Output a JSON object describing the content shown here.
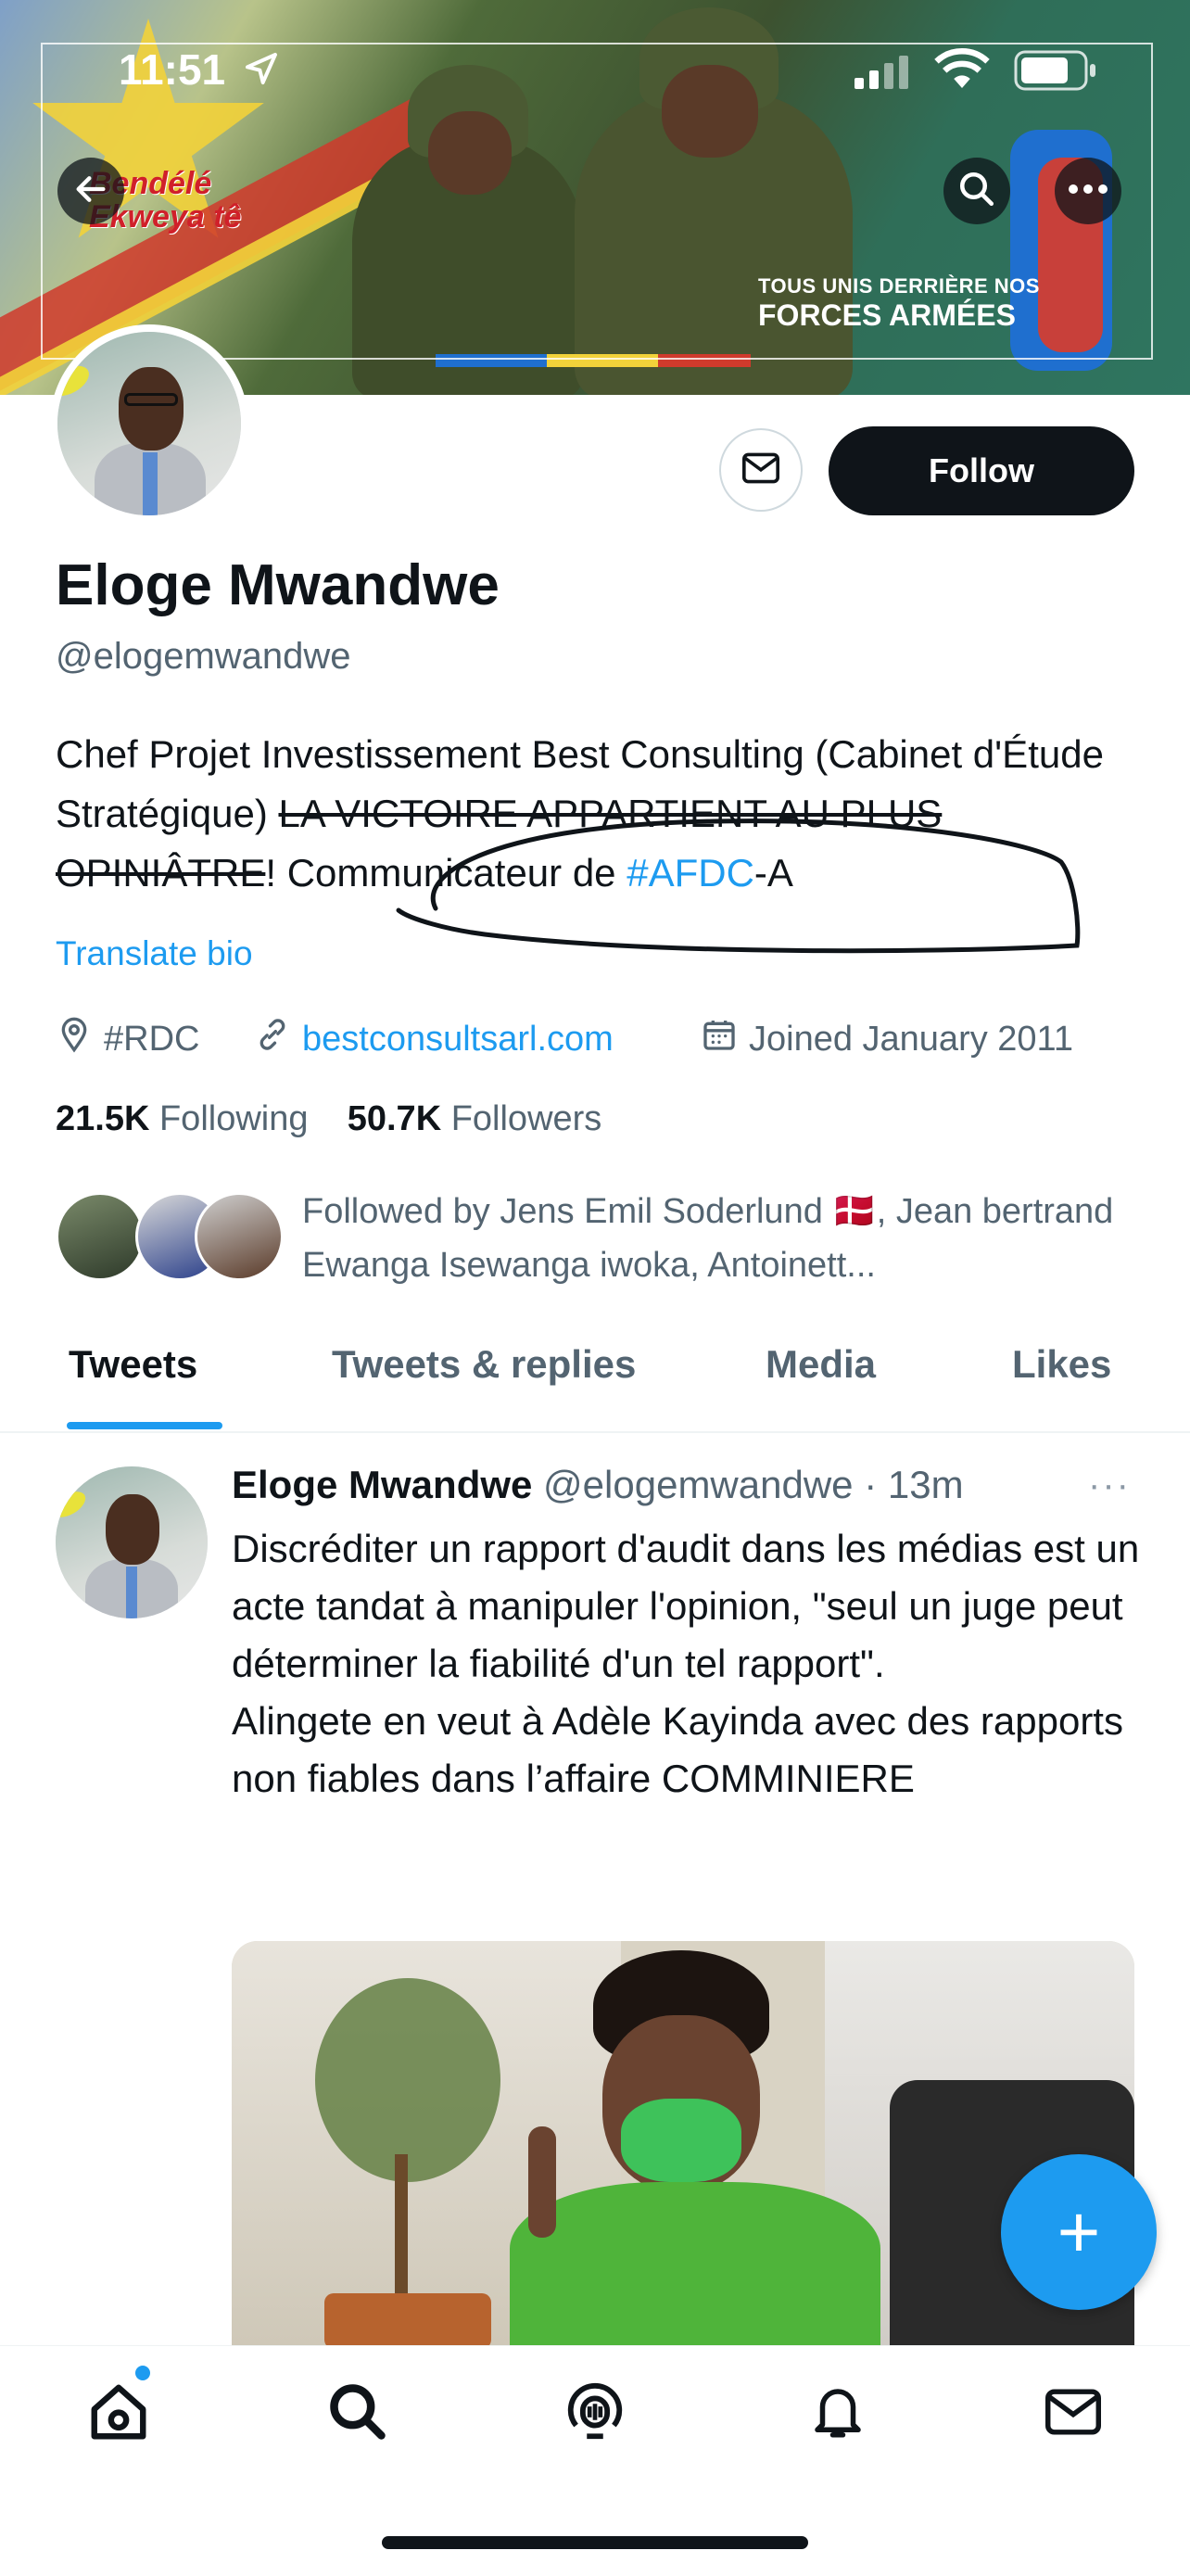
{
  "status_bar": {
    "time": "11:51"
  },
  "banner": {
    "logo_text": "Bendélé Ekweya tê",
    "slogan_line1": "TOUS UNIS DERRIÈRE NOS",
    "slogan_line2": "FORCES ARMÉES",
    "flag_colors": [
      "#1f6fcf",
      "#f2d23a",
      "#d03a2c"
    ]
  },
  "profile": {
    "name": "Eloge Mwandwe",
    "handle": "@elogemwandwe",
    "follow_label": "Follow",
    "bio_part1": "Chef Projet Investissement Best Consulting (Cabinet d'Étude Stratégique) ",
    "bio_strike": "LA VICTOIRE APPARTIENT AU PLUS OPINIÂTRE",
    "bio_part2": "! Communicateur de ",
    "bio_hashtag": "#AFDC",
    "bio_part3": "-A",
    "translate_label": "Translate bio",
    "location": "#RDC",
    "website": "bestconsultsarl.com",
    "joined": "Joined January 2011",
    "following_count": "21.5K",
    "following_label": "Following",
    "followers_count": "50.7K",
    "followers_label": "Followers",
    "followed_by": "Followed by Jens Emil Soderlund 🇩🇰, Jean bertrand Ewanga Isewanga iwoka, Antoinett..."
  },
  "tabs": [
    {
      "label": "Tweets"
    },
    {
      "label": "Tweets & replies"
    },
    {
      "label": "Media"
    },
    {
      "label": "Likes"
    }
  ],
  "tweet": {
    "name": "Eloge Mwandwe",
    "handle": "@elogemwandwe",
    "time": "· 13m",
    "more": "···",
    "text": "Discréditer un rapport d'audit dans les médias est un acte tandat à manipuler l'opinion, \"seul un juge peut déterminer la fiabilité d'un tel rapport\".\nAlingete en veut à Adèle Kayinda avec des rapports non fiables dans l’affaire COMMINIERE"
  },
  "fab": {
    "label": "+"
  },
  "icons": {
    "back": "back-arrow-icon",
    "search": "search-icon",
    "more": "more-icon",
    "message": "envelope-icon",
    "location": "location-pin-icon",
    "link": "link-icon",
    "calendar": "calendar-icon",
    "nav": [
      "home-icon",
      "search-icon",
      "spaces-icon",
      "bell-icon",
      "mail-icon"
    ]
  }
}
